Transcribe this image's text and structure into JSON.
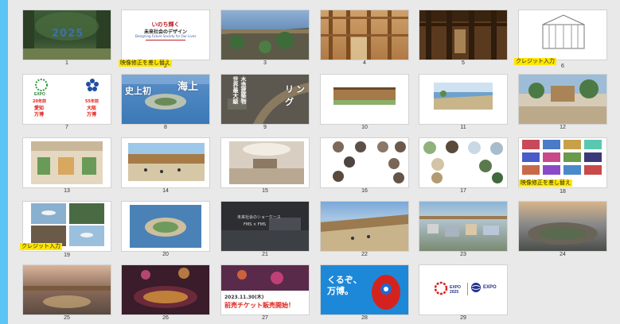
{
  "colors": {
    "accent_bar": "#5bc4f5",
    "sorter_bg": "#e9e9e9",
    "label_highlight": "#ffe600"
  },
  "slides": [
    {
      "num": "1",
      "thumb": "forest-2025-title",
      "big_text": "2025"
    },
    {
      "num": "2",
      "thumb": "design-title",
      "title": "いのち輝く",
      "subtitle": "未来社会のデザイン",
      "english": "Designing Future Society for Our Lives",
      "note": "映像修正を差し替え"
    },
    {
      "num": "3",
      "thumb": "rooftop-garden-photo"
    },
    {
      "num": "4",
      "thumb": "wooden-ring-interior-photo"
    },
    {
      "num": "5",
      "thumb": "wooden-ring-columns-photo"
    },
    {
      "num": "6",
      "thumb": "pavilion-sketch",
      "note": "クレジット入力"
    },
    {
      "num": "7",
      "thumb": "expo-logo-compare",
      "left_logo_text": "EXPO",
      "left_caption_1": "20年前",
      "left_caption_2": "愛知",
      "left_caption_3": "万博",
      "right_caption_1": "55年前",
      "right_caption_2": "大阪",
      "right_caption_3": "万博"
    },
    {
      "num": "8",
      "thumb": "aerial-island-photo",
      "text_1": "史上初",
      "text_2": "海上"
    },
    {
      "num": "9",
      "thumb": "ring-aerial-photo",
      "text_1": "世界最大級",
      "text_2": "木造建築物",
      "text_3": "リング"
    },
    {
      "num": "10",
      "thumb": "ring-exterior-render"
    },
    {
      "num": "11",
      "thumb": "waterfront-render"
    },
    {
      "num": "12",
      "thumb": "plaza-render"
    },
    {
      "num": "13",
      "thumb": "market-interior-render"
    },
    {
      "num": "14",
      "thumb": "ring-crowd-render"
    },
    {
      "num": "15",
      "thumb": "hall-interior-render"
    },
    {
      "num": "16",
      "thumb": "producers-portraits"
    },
    {
      "num": "17",
      "thumb": "pavilion-circles"
    },
    {
      "num": "18",
      "thumb": "pavilion-collage",
      "note": "映像修正を差し替え"
    },
    {
      "num": "19",
      "thumb": "flying-car-collage",
      "note": "クレジット入力"
    },
    {
      "num": "20",
      "thumb": "island-aerial-render"
    },
    {
      "num": "21",
      "thumb": "dark-night-render",
      "caption_1": "未来社会のショーケース",
      "caption_2": "FMS × FMS"
    },
    {
      "num": "22",
      "thumb": "ring-walkway-render"
    },
    {
      "num": "23",
      "thumb": "pavilions-aerial-render"
    },
    {
      "num": "24",
      "thumb": "sunset-aerial-render"
    },
    {
      "num": "25",
      "thumb": "evening-plaza-render"
    },
    {
      "num": "26",
      "thumb": "night-fireworks-render"
    },
    {
      "num": "27",
      "thumb": "ticket-announcement",
      "date": "2023.11.30(木)",
      "headline": "前売チケット販売開始！"
    },
    {
      "num": "28",
      "thumb": "mascot-poster",
      "line_1": "くるぞ、",
      "line_2": "万博。"
    },
    {
      "num": "29",
      "thumb": "expo-logos",
      "logo_1_text": "EXPO 2025",
      "logo_2_text": "EXPO"
    }
  ]
}
